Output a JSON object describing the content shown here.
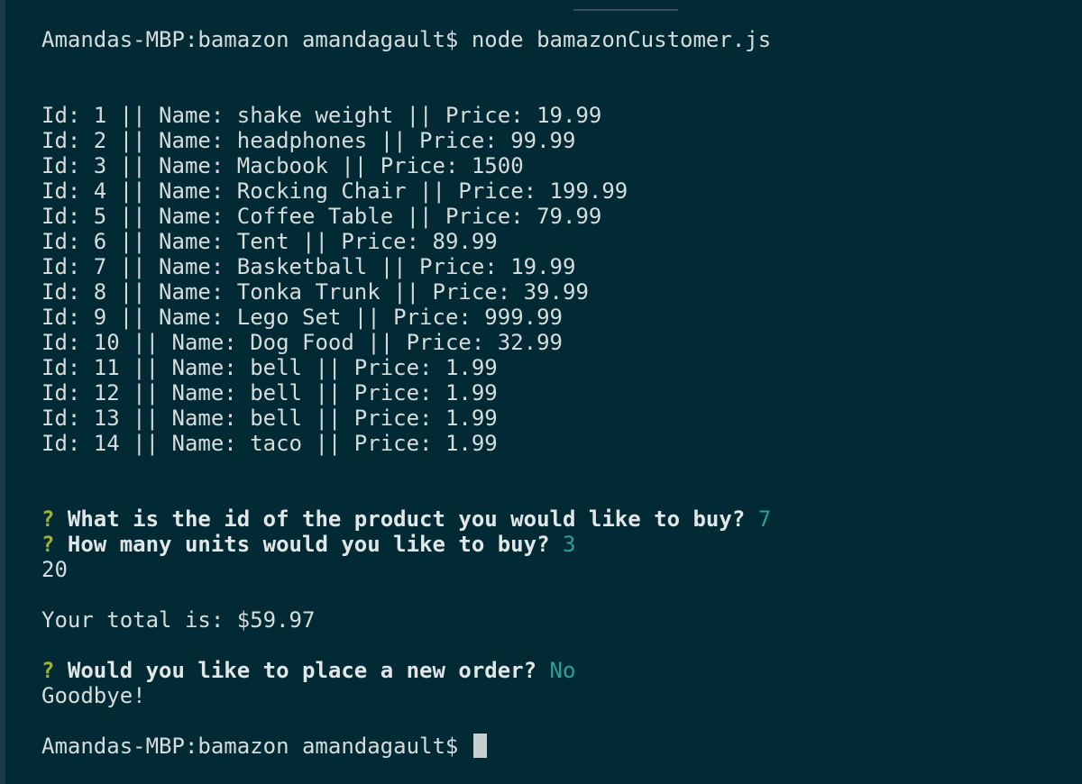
{
  "terminal": {
    "prompt": "Amandas-MBP:bamazon amandagault$",
    "command": "node bamazonCustomer.js",
    "products": [
      {
        "id": "1",
        "name": "shake weight",
        "price": "19.99"
      },
      {
        "id": "2",
        "name": "headphones",
        "price": "99.99"
      },
      {
        "id": "3",
        "name": "Macbook",
        "price": "1500"
      },
      {
        "id": "4",
        "name": "Rocking Chair",
        "price": "199.99"
      },
      {
        "id": "5",
        "name": "Coffee Table",
        "price": "79.99"
      },
      {
        "id": "6",
        "name": "Tent",
        "price": "89.99"
      },
      {
        "id": "7",
        "name": "Basketball",
        "price": "19.99"
      },
      {
        "id": "8",
        "name": "Tonka Trunk",
        "price": "39.99"
      },
      {
        "id": "9",
        "name": "Lego Set",
        "price": "999.99"
      },
      {
        "id": "10",
        "name": "Dog Food",
        "price": "32.99"
      },
      {
        "id": "11",
        "name": "bell",
        "price": "1.99"
      },
      {
        "id": "12",
        "name": "bell",
        "price": "1.99"
      },
      {
        "id": "13",
        "name": "bell",
        "price": "1.99"
      },
      {
        "id": "14",
        "name": "taco",
        "price": "1.99"
      }
    ],
    "question_mark": "?",
    "q1": {
      "text": "What is the id of the product you would like to buy?",
      "answer": "7"
    },
    "q2": {
      "text": "How many units would you like to buy?",
      "answer": "3"
    },
    "stock_output": "20",
    "total_line": "Your total is: $59.97",
    "q3": {
      "text": "Would you like to place a new order?",
      "answer": "No"
    },
    "goodbye": "Goodbye!"
  },
  "colors": {
    "background": "#022a35",
    "text": "#d6dcdc",
    "question_mark": "#a6b12b",
    "answer": "#2aa198"
  }
}
